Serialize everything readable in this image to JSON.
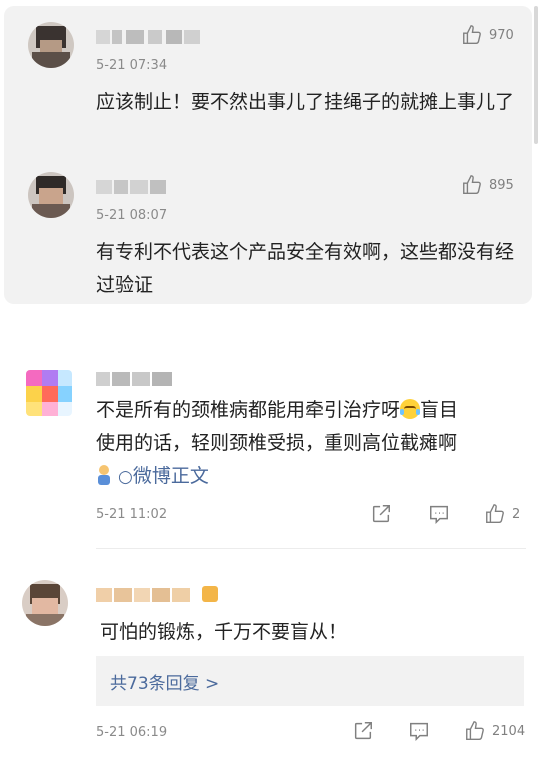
{
  "comments": [
    {
      "time": "5-21 07:34",
      "text": "应该制止！要不然出事儿了挂绳子的就摊上事儿了",
      "likes": "970",
      "icon": "thumbs-up-icon"
    },
    {
      "time": "5-21 08:07",
      "text": "有专利不代表这个产品安全有效啊，这些都没有经过验证",
      "likes": "895",
      "icon": "thumbs-up-icon"
    },
    {
      "time": "5-21 11:02",
      "text_line1": "不是所有的颈椎病都能用牵引治疗呀",
      "text_line1_cont": "盲目",
      "text_line2": "使用的话，轻则颈椎受损，重则高位截瘫啊",
      "weibo_link": "微博正文",
      "likes": "2",
      "icons": [
        "share-icon",
        "comment-icon",
        "thumbs-up-icon",
        "laughing-tears-emoji",
        "figure-emoji",
        "weibo-link-icon"
      ]
    },
    {
      "time": "5-21 06:19",
      "text": "可怕的锻炼，千万不要盲从！",
      "likes": "2104",
      "replies_link": "共73条回复 >",
      "icons": [
        "share-icon",
        "comment-icon",
        "thumbs-up-icon",
        "vip-badge-icon"
      ]
    }
  ],
  "colors": {
    "link": "#4b6a9c",
    "meta": "#8a8a8a",
    "quoted_bg": "#f2f2f2"
  }
}
